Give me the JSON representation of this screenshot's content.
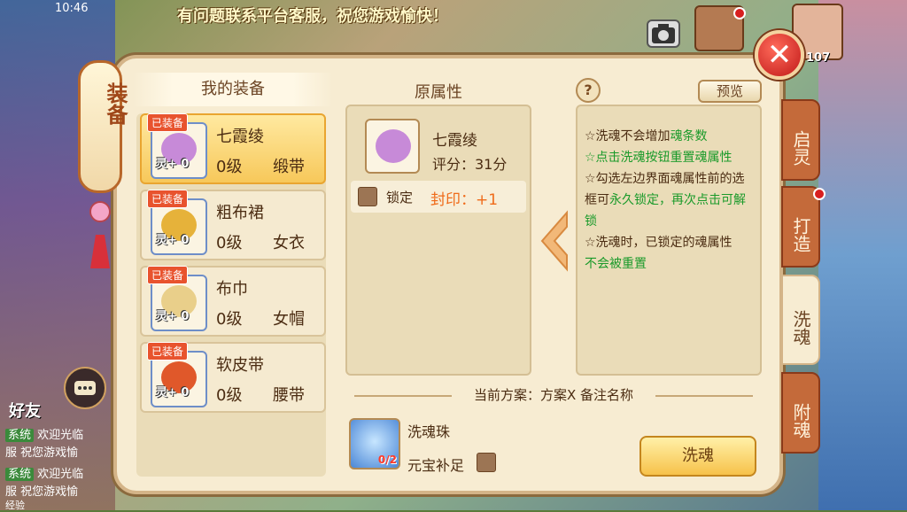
{
  "status": {
    "time": "10:46"
  },
  "notice": "有问题联系平台客服，祝您游戏愉快！",
  "player": {
    "level": "107"
  },
  "lantern": {
    "title": "装备"
  },
  "left_panel": {
    "title": "我的装备",
    "items": [
      {
        "tag": "已装备",
        "spirit": "灵+ 0",
        "name": "七霞绫",
        "level": "0级",
        "type": "缎带",
        "selected": true
      },
      {
        "tag": "已装备",
        "spirit": "灵+ 0",
        "name": "粗布裙",
        "level": "0级",
        "type": "女衣"
      },
      {
        "tag": "已装备",
        "spirit": "灵+ 0",
        "name": "布巾",
        "level": "0级",
        "type": "女帽"
      },
      {
        "tag": "已装备",
        "spirit": "灵+ 0",
        "name": "软皮带",
        "level": "0级",
        "type": "腰带"
      }
    ]
  },
  "attributes": {
    "title": "原属性",
    "item_name": "七霞绫",
    "score": "评分：31分",
    "lock_label": "锁定",
    "seal_text": "封印：+1"
  },
  "help": {
    "icon": "?",
    "preview_label": "预览"
  },
  "info": {
    "line1_a": "☆洗魂不会增加",
    "line1_b": "魂条数",
    "line2": "☆点击洗魂按钮重置魂属性",
    "line3_a": "☆勾选左边界面魂属性前的选框可",
    "line3_b": "永久锁定，再次点击可解锁",
    "line4_a": "☆洗魂时，已锁定的魂属性",
    "line4_b": "不会被重置"
  },
  "scheme": "当前方案：方案X  备注名称",
  "consumable": {
    "name": "洗魂珠",
    "count": "0/2",
    "supplement_label": "元宝补足"
  },
  "wash_button": "洗魂",
  "tabs": [
    "启灵",
    "打造",
    "洗魂",
    "附魂"
  ],
  "active_tab": "洗魂",
  "chat": {
    "friend_label": "好友",
    "rows": [
      {
        "tag": "系统",
        "text": "欢迎光临"
      },
      {
        "tag": "",
        "text": "服 祝您游戏愉"
      },
      {
        "tag": "系统",
        "text": "欢迎光临"
      },
      {
        "tag": "",
        "text": "服 祝您游戏愉"
      }
    ],
    "exp_label": "经验"
  },
  "colors": {
    "accent": "#f7c24a",
    "green_text": "#1a9a2a",
    "seal_orange": "#ef6b1a",
    "close_red": "#c01818"
  },
  "icons": [
    "close-icon",
    "help-icon",
    "camera-icon",
    "chat-icon",
    "lock-checkbox",
    "arrow-left-icon",
    "soul-gem-icon"
  ]
}
